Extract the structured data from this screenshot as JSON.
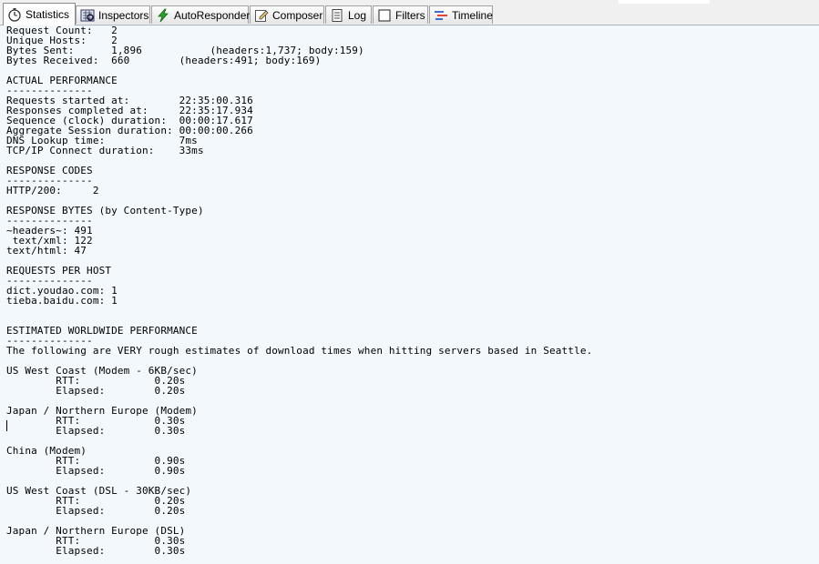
{
  "tabs": [
    {
      "label": "Statistics",
      "icon": "stopwatch-icon",
      "active": true
    },
    {
      "label": "Inspectors",
      "icon": "inspector-icon"
    },
    {
      "label": "AutoResponder",
      "icon": "lightning-icon"
    },
    {
      "label": "Composer",
      "icon": "compose-icon"
    },
    {
      "label": "Log",
      "icon": "log-icon"
    },
    {
      "label": "Filters",
      "icon": "checkbox-icon"
    },
    {
      "label": "Timeline",
      "icon": "timeline-icon"
    }
  ],
  "stats_lines": [
    "Request Count:   2",
    "Unique Hosts:    2",
    "Bytes Sent:      1,896           (headers:1,737; body:159)",
    "Bytes Received:  660        (headers:491; body:169)",
    "",
    "ACTUAL PERFORMANCE",
    "--------------",
    "Requests started at:        22:35:00.316",
    "Responses completed at:     22:35:17.934",
    "Sequence (clock) duration:  00:00:17.617",
    "Aggregate Session duration: 00:00:00.266",
    "DNS Lookup time:            7ms",
    "TCP/IP Connect duration:    33ms",
    "",
    "RESPONSE CODES",
    "--------------",
    "HTTP/200:     2",
    "",
    "RESPONSE BYTES (by Content-Type)",
    "--------------",
    "~headers~: 491",
    " text/xml: 122",
    "text/html: 47",
    "",
    "REQUESTS PER HOST",
    "--------------",
    "dict.youdao.com: 1",
    "tieba.baidu.com: 1",
    "",
    "",
    "ESTIMATED WORLDWIDE PERFORMANCE",
    "--------------",
    "The following are VERY rough estimates of download times when hitting servers based in Seattle.",
    "",
    "US West Coast (Modem - 6KB/sec)",
    "\tRTT:\t\t0.20s",
    "\tElapsed:\t0.20s",
    "",
    "Japan / Northern Europe (Modem)",
    "\tRTT:\t\t0.30s",
    "\tElapsed:\t0.30s",
    "",
    "China (Modem)",
    "\tRTT:\t\t0.90s",
    "\tElapsed:\t0.90s",
    "",
    "US West Coast (DSL - 30KB/sec)",
    "\tRTT:\t\t0.20s",
    "\tElapsed:\t0.20s",
    "",
    "Japan / Northern Europe (DSL)",
    "\tRTT:\t\t0.30s",
    "\tElapsed:\t0.30s"
  ]
}
